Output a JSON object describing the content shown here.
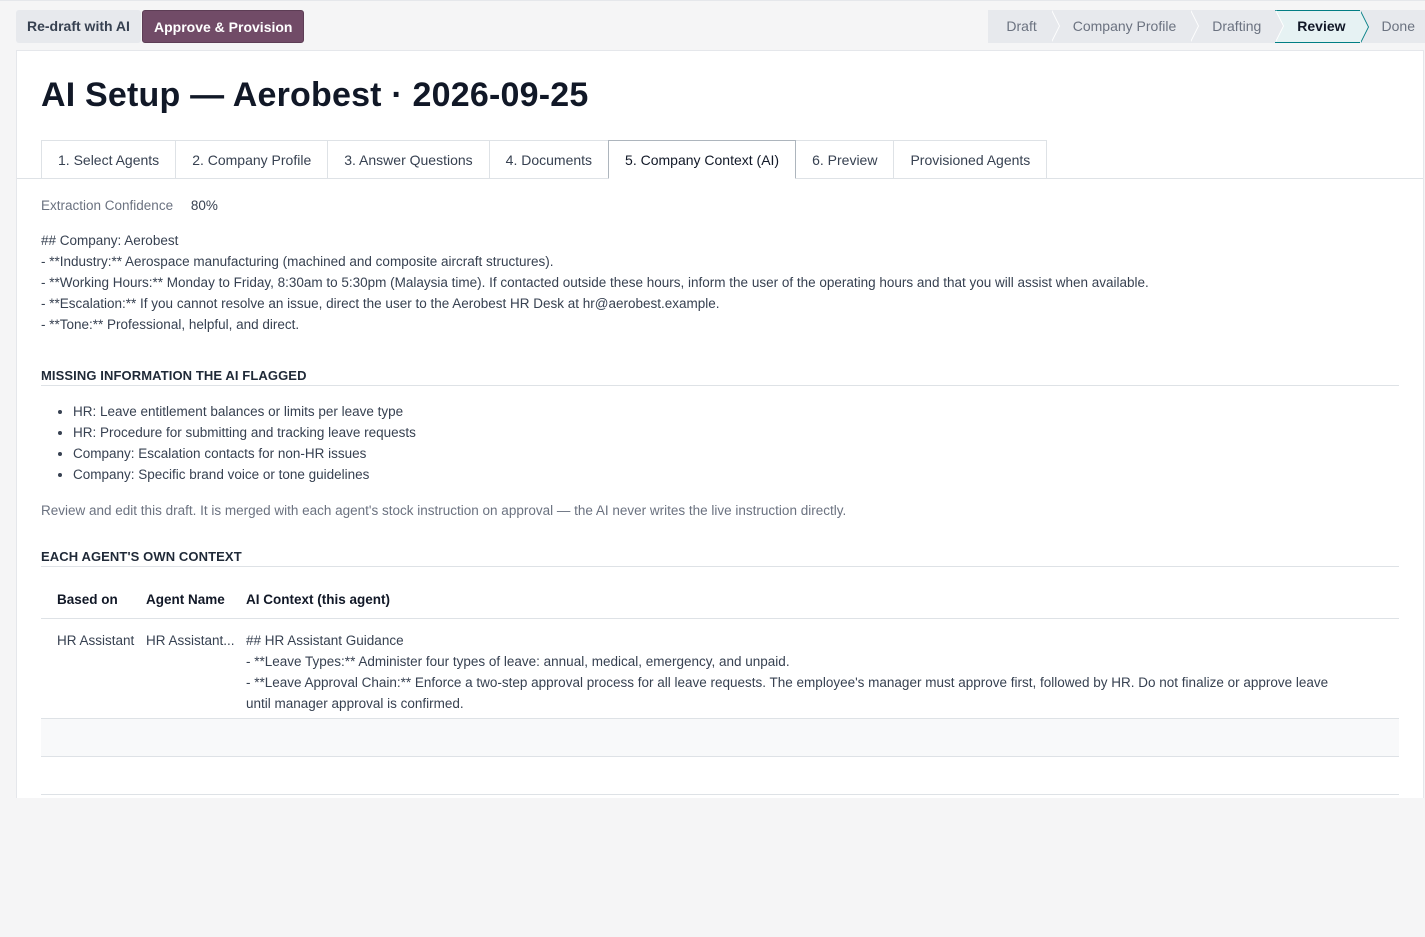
{
  "toolbar": {
    "redraft_label": "Re-draft with AI",
    "approve_label": "Approve & Provision"
  },
  "status_bar": {
    "stages": [
      {
        "label": "Draft",
        "active": false
      },
      {
        "label": "Company Profile",
        "active": false
      },
      {
        "label": "Drafting",
        "active": false
      },
      {
        "label": "Review",
        "active": true
      },
      {
        "label": "Done",
        "active": false
      }
    ]
  },
  "form": {
    "title": "AI Setup — Aerobest · 2026-09-25",
    "tabs": [
      {
        "label": "1. Select Agents",
        "active": false
      },
      {
        "label": "2. Company Profile",
        "active": false
      },
      {
        "label": "3. Answer Questions",
        "active": false
      },
      {
        "label": "4. Documents",
        "active": false
      },
      {
        "label": "5. Company Context (AI)",
        "active": true
      },
      {
        "label": "6. Preview",
        "active": false
      },
      {
        "label": "Provisioned Agents",
        "active": false
      }
    ],
    "extraction_confidence_label": "Extraction Confidence",
    "extraction_confidence_value": "80%",
    "company_context_lines": [
      "## Company: Aerobest",
      "- **Industry:** Aerospace manufacturing (machined and composite aircraft structures).",
      "- **Working Hours:** Monday to Friday, 8:30am to 5:30pm (Malaysia time). If contacted outside these hours, inform the user of the operating hours and that you will assist when available.",
      "- **Escalation:** If you cannot resolve an issue, direct the user to the Aerobest HR Desk at hr@aerobest.example.",
      "- **Tone:** Professional, helpful, and direct."
    ],
    "missing_section_title": "MISSING INFORMATION THE AI FLAGGED",
    "missing_items": [
      "HR: Leave entitlement balances or limits per leave type",
      "HR: Procedure for submitting and tracking leave requests",
      "Company: Escalation contacts for non-HR issues",
      "Company: Specific brand voice or tone guidelines"
    ],
    "help_text": "Review and edit this draft. It is merged with each agent's stock instruction on approval — the AI never writes the live instruction directly.",
    "agents_section_title": "EACH AGENT'S OWN CONTEXT",
    "agents_table": {
      "columns": [
        "Based on",
        "Agent Name",
        "AI Context (this agent)"
      ],
      "rows": [
        {
          "based_on": "HR Assistant",
          "agent_name": "HR Assistant...",
          "context_lines": [
            "## HR Assistant Guidance",
            "- **Leave Types:** Administer four types of leave: annual, medical, emergency, and unpaid.",
            "- **Leave Approval Chain:** Enforce a two-step approval process for all leave requests. The employee's manager must approve first, followed by HR. Do not finalize or approve leave",
            "until manager approval is confirmed."
          ]
        }
      ]
    }
  },
  "colors": {
    "primary": "#714b67",
    "active_stage": "#017e84"
  }
}
